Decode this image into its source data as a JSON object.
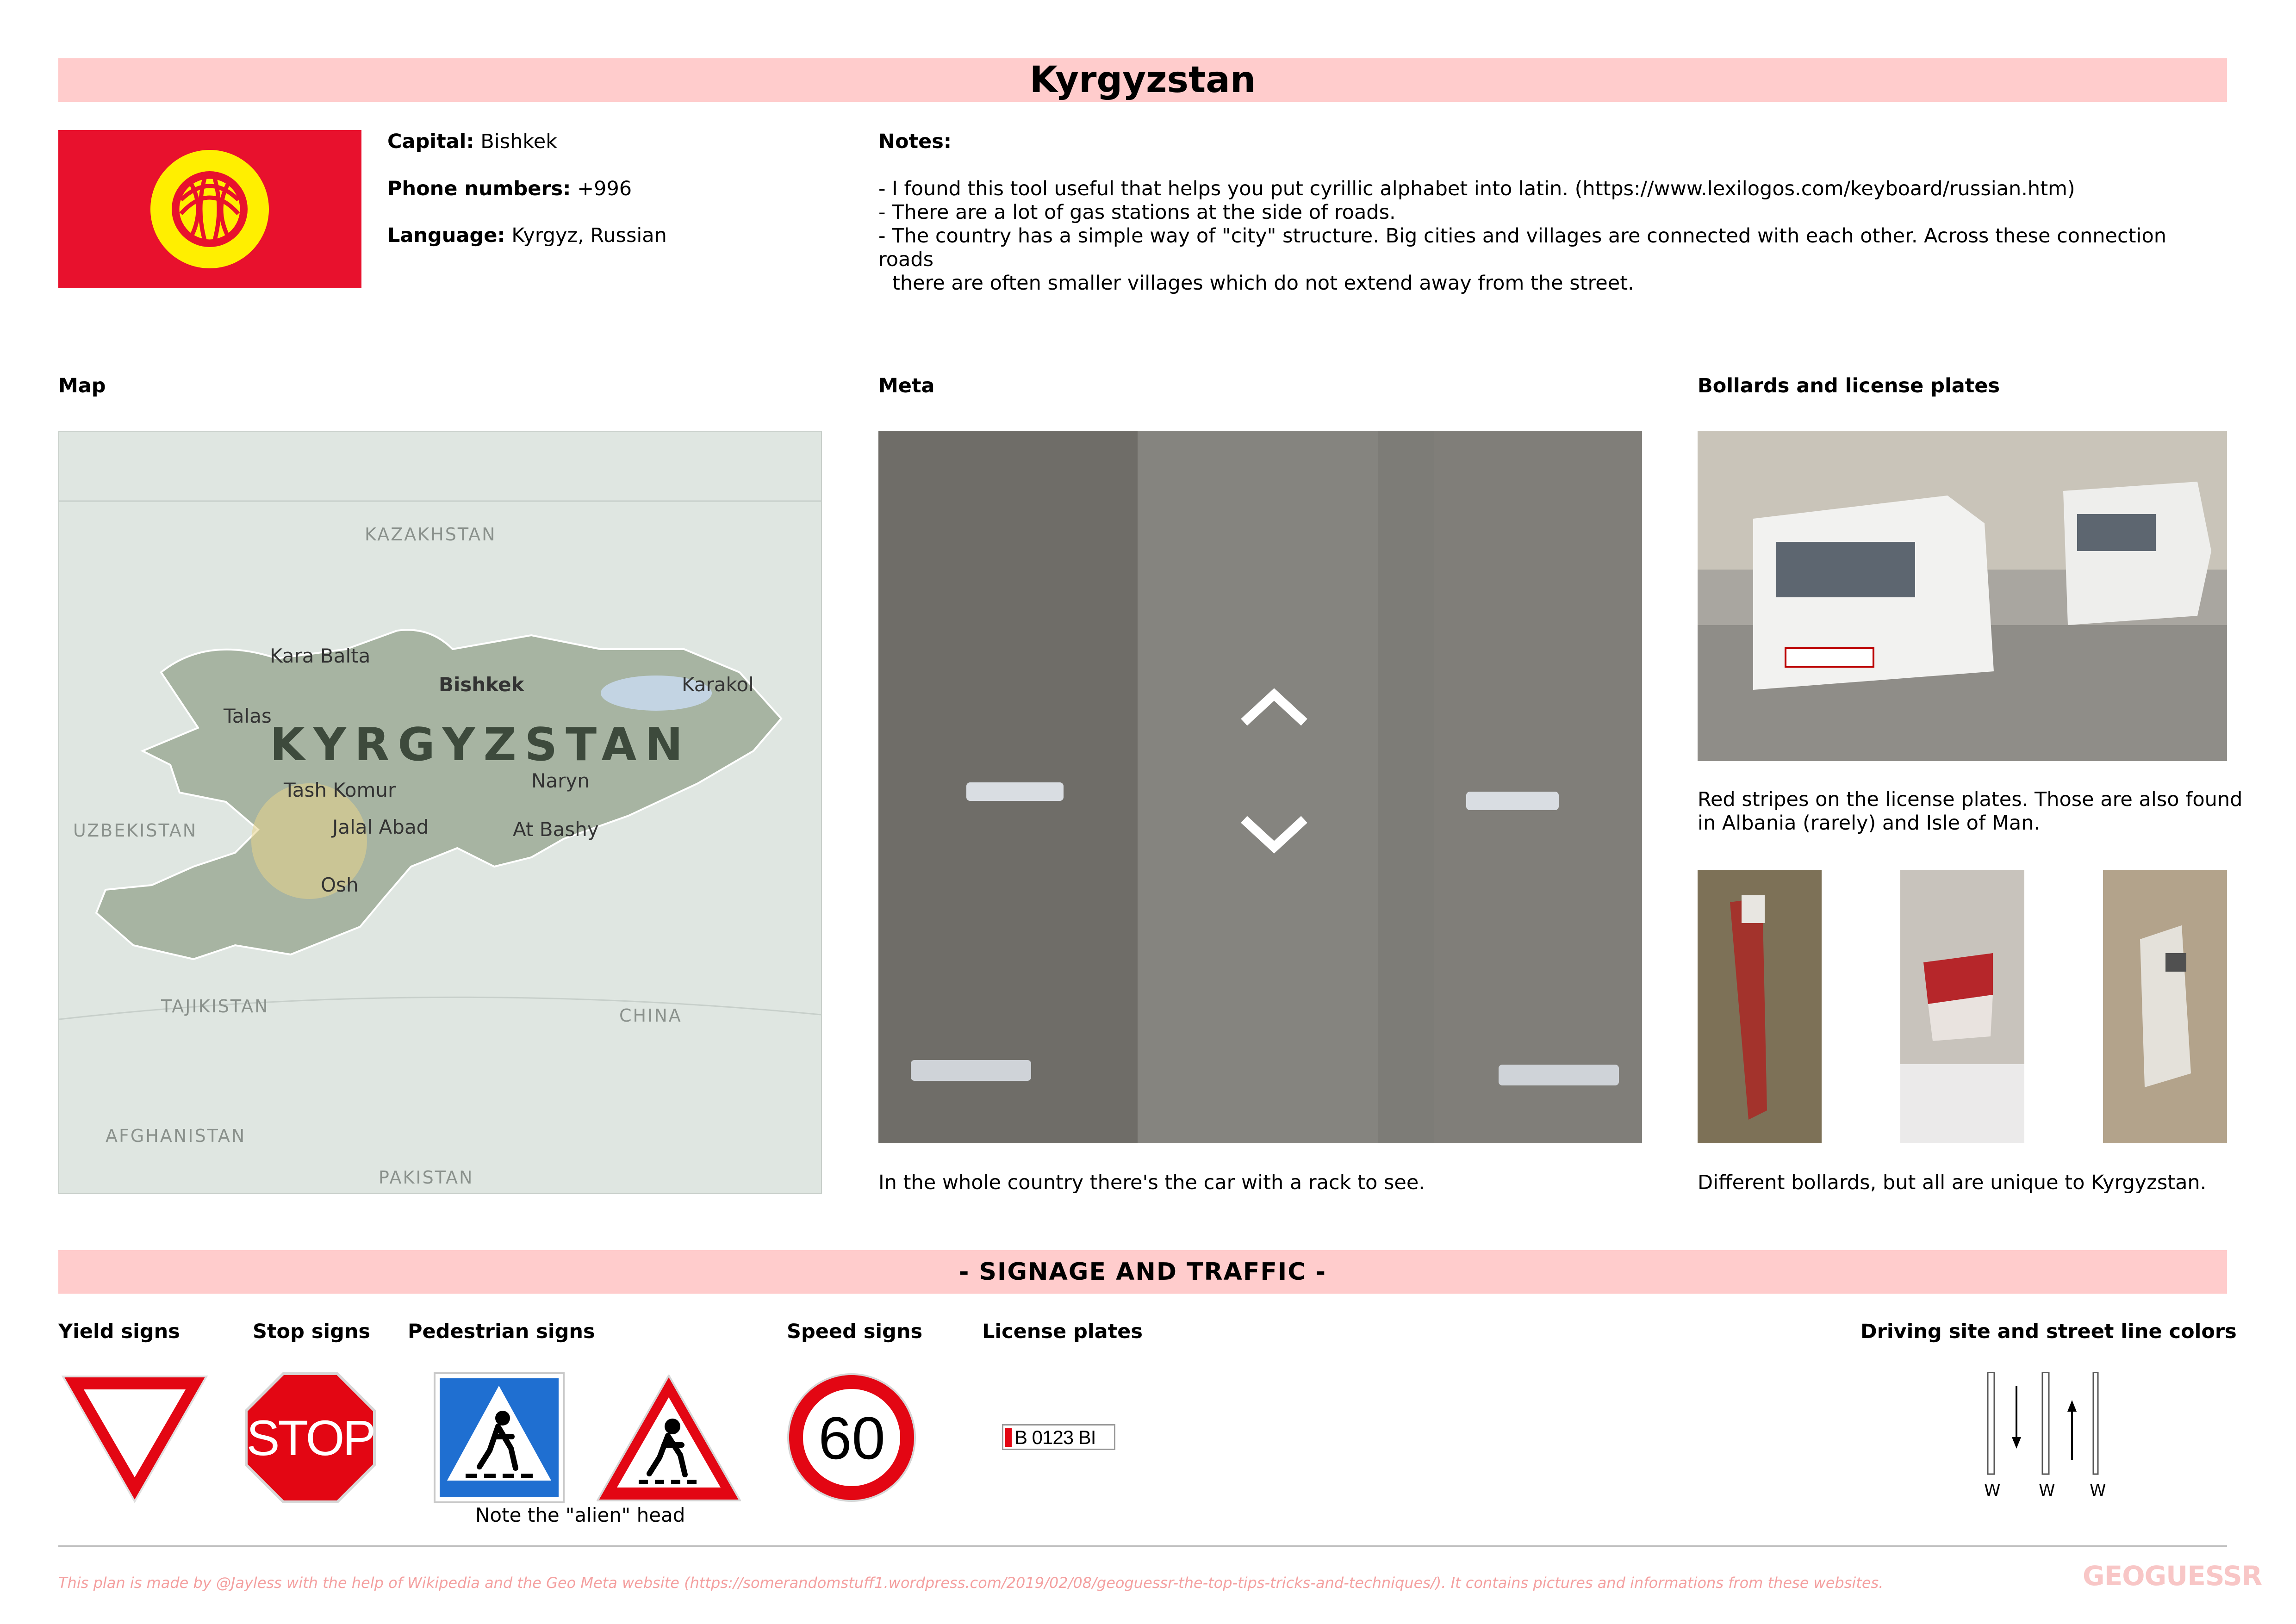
{
  "title": "Kyrgyzstan",
  "facts": {
    "capital_label": "Capital:",
    "capital_value": "Bishkek",
    "phone_label": "Phone numbers:",
    "phone_value": "+996",
    "language_label": "Language:",
    "language_value": "Kyrgyz, Russian"
  },
  "notes": {
    "heading": "Notes:",
    "lines": [
      "- I found this tool useful that helps you put cyrillic alphabet into latin. (https://www.lexilogos.com/keyboard/russian.htm)",
      "- There are a lot of gas stations at the side of roads.",
      "- The country has a simple way of \"city\" structure. Big cities and villages are connected with each other. Across these connection roads",
      "there are often smaller villages which do not extend away from the street."
    ]
  },
  "sections": {
    "map": "Map",
    "meta": "Meta",
    "bollards": "Bollards and license plates"
  },
  "map": {
    "country": "KYRGYZSTAN",
    "neighbors": [
      "KAZAKHSTAN",
      "UZBEKISTAN",
      "TAJIKISTAN",
      "CHINA",
      "AFGHANISTAN",
      "PAKISTAN"
    ],
    "cities": [
      "Kara Balta",
      "Bishkek",
      "Karakol",
      "Talas",
      "Tash Komur",
      "Naryn",
      "Jalal Abad",
      "At Bashy",
      "Osh"
    ]
  },
  "captions": {
    "meta": "In the whole country there's the car with a rack to see.",
    "plates_1": "Red stripes on the license plates. Those are also found",
    "plates_2": "in Albania (rarely) and Isle of Man.",
    "bollards": "Different bollards, but all are unique to Kyrgyzstan."
  },
  "signage": {
    "banner": "- SIGNAGE AND TRAFFIC -",
    "yield": "Yield signs",
    "stop": "Stop signs",
    "stop_text": "STOP",
    "pedestrian": "Pedestrian signs",
    "pedestrian_note": "Note the \"alien\" head",
    "speed": "Speed signs",
    "speed_value": "60",
    "plates": "License plates",
    "plate_text": "B 0123 BI",
    "driving": "Driving site and street line colors",
    "lane_letters": [
      "W",
      "W",
      "W"
    ]
  },
  "footer": {
    "text": "This plan is made by @Jayless with the help of Wikipedia and the Geo Meta website (https://somerandomstuff1.wordpress.com/2019/02/08/geoguessr-the-top-tips-tricks-and-techniques/). It contains pictures and informations from these websites.",
    "logo": "GEOGUESSR"
  },
  "colors": {
    "banner": "#ffcccc",
    "flag_red": "#e8112d",
    "flag_sun": "#ffef00",
    "sign_red": "#e30613",
    "ped_blue": "#1f6fd1",
    "footer_text": "#f4a0a0"
  }
}
